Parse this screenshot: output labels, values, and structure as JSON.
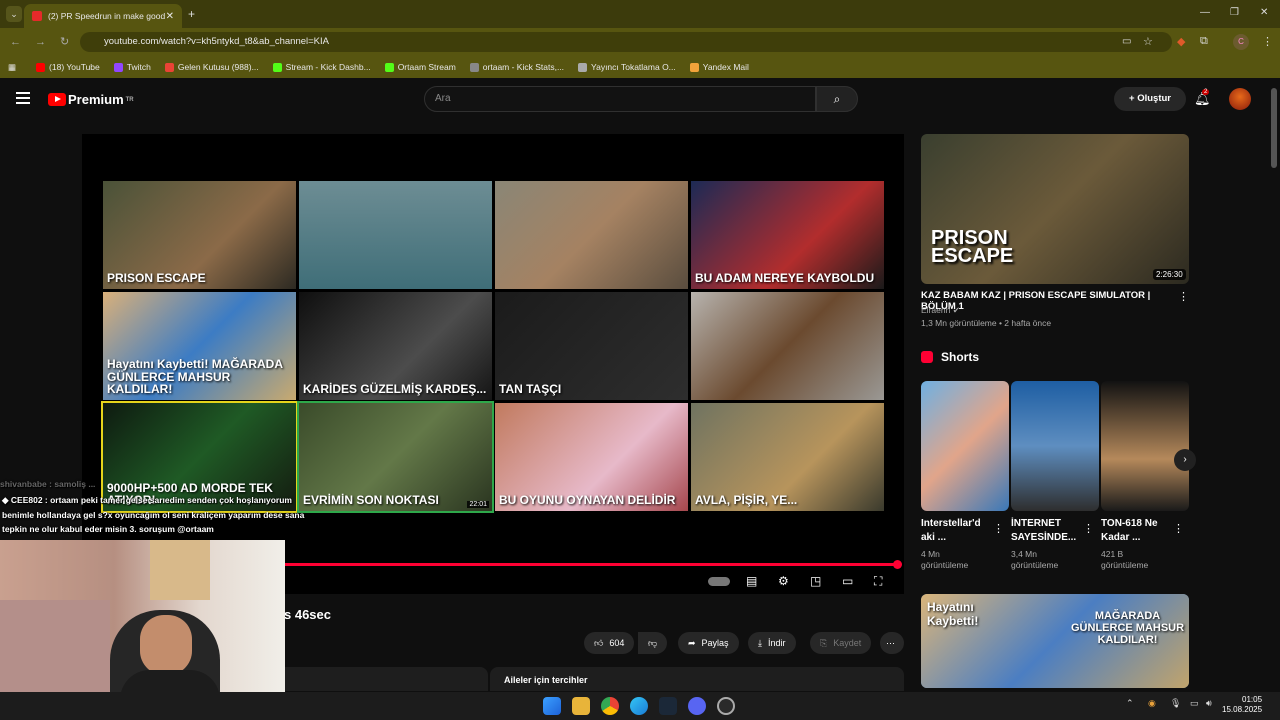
{
  "browser": {
    "tab_title": "(2) PR Speedrun in make good",
    "url": "youtube.com/watch?v=kh5ntykd_t8&ab_channel=KIA",
    "bookmarks": [
      {
        "label": "(18) YouTube",
        "color": "#ff0000"
      },
      {
        "label": "Twitch",
        "color": "#9146ff"
      },
      {
        "label": "Gelen Kutusu (988)...",
        "color": "#ea4335"
      },
      {
        "label": "Stream - Kick Dashb...",
        "color": "#53fc18"
      },
      {
        "label": "Ortaam Stream",
        "color": "#53fc18"
      },
      {
        "label": "ortaam - Kick Stats,...",
        "color": "#888888"
      },
      {
        "label": "Yayıncı Tokatlama O...",
        "color": "#aaaaaa"
      },
      {
        "label": "Yandex Mail",
        "color": "#f2a33a"
      }
    ]
  },
  "youtube": {
    "logo": "Premium",
    "logo_sup": "TR",
    "search_placeholder": "Ara",
    "create_label": "+ Oluştur",
    "notif_count": "2"
  },
  "player": {
    "endscreen": [
      {
        "label": "",
        "bg": "linear-gradient(135deg,#4a5238,#8b6a48 60%,#2d2a22)",
        "text": "PRISON ESCAPE"
      },
      {
        "label": "",
        "bg": "linear-gradient(180deg,#6d8d94,#3f6e78)",
        "text": ""
      },
      {
        "label": "",
        "bg": "linear-gradient(135deg,#8a8676,#a58262 50%,#5a4d3e)",
        "text": ""
      },
      {
        "label": "",
        "bg": "linear-gradient(135deg,#1c2a55,#b22d2d 60%,#1a1a1a)",
        "text": "BU ADAM NEREYE KAYBOLDU"
      },
      {
        "label": "",
        "bg": "linear-gradient(135deg,#d9b07a,#3c7cc4 50%,#c9aa6f)",
        "text": "Hayatını Kaybetti! MAĞARADA GÜNLERCE MAHSUR KALDILAR!"
      },
      {
        "label": "",
        "bg": "linear-gradient(135deg,#0f0f0f,#4c4c4c 60%,#151515)",
        "text": "KARİDES GÜZELMİŞ KARDEŞ..."
      },
      {
        "label": "",
        "bg": "linear-gradient(135deg,#1b1b1b,#2e2e2e)",
        "text": "TAN TAŞÇI"
      },
      {
        "label": "",
        "bg": "linear-gradient(135deg,#b7b3ae,#6b4a2f 50%,#9a9894)",
        "text": ""
      },
      {
        "label": "",
        "bg": "linear-gradient(135deg,#0e1a10,#1f5a25 50%,#141b10)",
        "text": "9000HP+500 AD MORDE TEK ATIYOR!"
      },
      {
        "label": "",
        "bg": "linear-gradient(135deg,#3a4b2a,#637848 50%,#2a3520)",
        "text": "EVRİMİN SON NOKTASI",
        "dur": "22:01"
      },
      {
        "label": "",
        "bg": "linear-gradient(135deg,#c17a5e,#e7b9c9 60%,#a5474d)",
        "text": "BU OYUNU OYNAYAN DELİDİR"
      },
      {
        "label": "",
        "bg": "linear-gradient(135deg,#6f7360,#b7945c 60%,#3a3a2d)",
        "text": "AVLA, PİŞİR, YE..."
      }
    ],
    "progress": 0.995
  },
  "video": {
    "title_fragment": "s 46sec",
    "likes": "604",
    "share": "Paylaş",
    "download": "İndir",
    "save": "Kaydet",
    "prefs": "Aileler için tercihler"
  },
  "sidebar": {
    "top": {
      "duration": "2:26:30",
      "title": "KAZ BABAM KAZ | PRISON ESCAPE SIMULATOR | BÖLÜM 1",
      "channel": "Elraenn",
      "meta": "1,3 Mn görüntüleme • 2 hafta önce"
    },
    "shorts_heading": "Shorts",
    "shorts": [
      {
        "t1": "Interstellar'd",
        "t2": "aki ...",
        "v1": "4 Mn",
        "v2": "görüntüleme",
        "bg": "linear-gradient(135deg,#6fb0e2,#e1a58a 50%,#3a78b8)"
      },
      {
        "t1": "İNTERNET",
        "t2": "SAYESİNDE...",
        "v1": "3,4 Mn",
        "v2": "görüntüleme",
        "bg": "linear-gradient(180deg,#1e5ea3,#5e8ec0 50%,#2e2e2e)"
      },
      {
        "t1": "TON-618 Ne",
        "t2": "Kadar ...",
        "v1": "421 B",
        "v2": "görüntüleme",
        "bg": "linear-gradient(180deg,#121212,#b5895b 60%,#1a1a1a)"
      }
    ]
  },
  "overlay": {
    "chat0": "shivanbabe : samoliş ...",
    "chat1": "◆ CEE802 : ortaam peki tamer gelse sarıedim senden çok hoşlanıyorum",
    "chat2": "benimle hollandaya gel s?x oyuncağım ol seni kraliçem yaparım dese sana",
    "chat3": "tepkin ne olur kabul eder misin 3. soruşum @ortaam"
  },
  "taskbar": {
    "time": "01:05",
    "date": "15.08.2025"
  }
}
